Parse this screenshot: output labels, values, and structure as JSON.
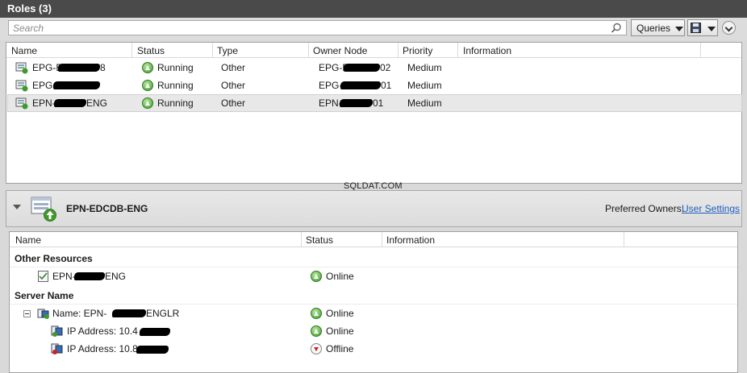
{
  "window": {
    "title": "Roles (3)"
  },
  "toolbar": {
    "search_placeholder": "Search",
    "queries_label": "Queries"
  },
  "roles_grid": {
    "columns": [
      "Name",
      "Status",
      "Type",
      "Owner Node",
      "Priority",
      "Information"
    ],
    "rows": [
      {
        "name": "EPG-B",
        "name_tail": "8",
        "status": "Running",
        "type": "Other",
        "owner": "EPG-E",
        "owner_tail": "02",
        "priority": "Medium",
        "information": ""
      },
      {
        "name": "EPG-",
        "name_tail": "",
        "status": "Running",
        "type": "Other",
        "owner": "EPG-",
        "owner_tail": "01",
        "priority": "Medium",
        "information": ""
      },
      {
        "name": "EPN-",
        "name_tail": "ENG",
        "status": "Running",
        "type": "Other",
        "owner": "EPN-",
        "owner_tail": "01",
        "priority": "Medium",
        "information": ""
      }
    ]
  },
  "watermark": "SQLDAT.COM",
  "detail": {
    "role_name": "EPN-EDCDB-ENG",
    "preferred_owners_label": "Preferred Owners:",
    "user_settings_link": "User Settings",
    "columns": [
      "Name",
      "Status",
      "Information"
    ],
    "groups": [
      {
        "title": "Other Resources",
        "items": [
          {
            "name": "EPN-",
            "name_tail": "ENG",
            "status": "Online",
            "state": "online"
          }
        ]
      },
      {
        "title": "Server Name",
        "items": [
          {
            "name": "Name: EPN-",
            "name_tail": "ENGLR",
            "status": "Online",
            "state": "online"
          },
          {
            "name": "IP Address: 10.4",
            "name_tail": "",
            "status": "Online",
            "state": "online"
          },
          {
            "name": "IP Address: 10.8",
            "name_tail": "",
            "status": "Offline",
            "state": "offline"
          }
        ]
      }
    ]
  },
  "colors": {
    "title_bar": "#4a4a4a",
    "link": "#1d5fbf",
    "online": "#3f9a2c",
    "offline": "#cc2222"
  }
}
